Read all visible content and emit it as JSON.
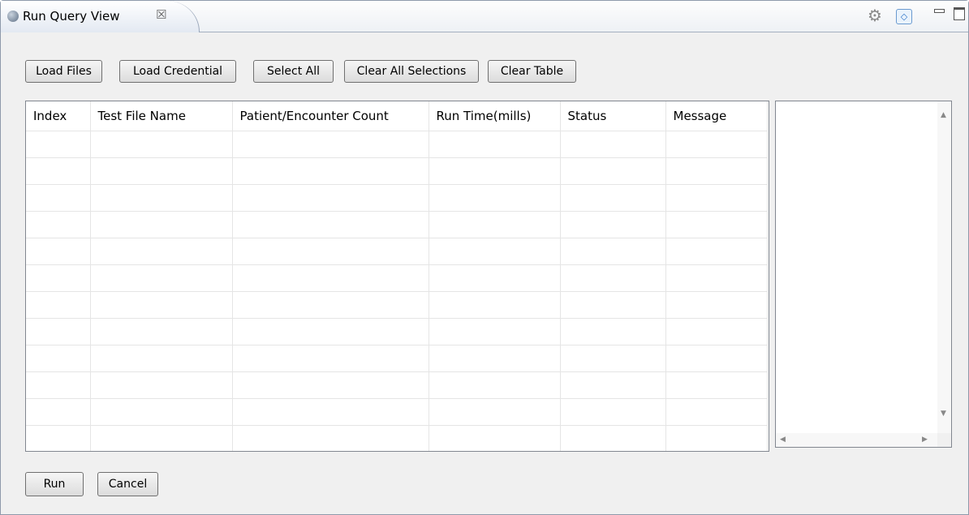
{
  "tab": {
    "title": "Run Query View",
    "close_glyph": "☒"
  },
  "toolbar_icons": {
    "gear": "gear-icon",
    "nav": "nav-icon"
  },
  "buttons": {
    "load_files": "Load Files",
    "load_credential": "Load Credential",
    "select_all": "Select All",
    "clear_all_selections": "Clear All Selections",
    "clear_table": "Clear Table"
  },
  "table": {
    "columns": [
      "Index",
      "Test File Name",
      "Patient/Encounter Count",
      "Run Time(mills)",
      "Status",
      "Message"
    ],
    "rows": []
  },
  "footer": {
    "run": "Run",
    "cancel": "Cancel"
  }
}
